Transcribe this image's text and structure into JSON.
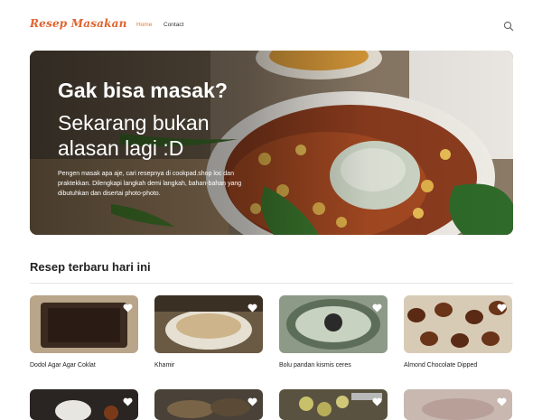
{
  "navbar": {
    "brand": "Resep Masakan",
    "links": [
      {
        "label": "Home",
        "active": true
      },
      {
        "label": "Contact",
        "active": false
      }
    ],
    "search_icon": "search-icon"
  },
  "hero": {
    "heading": "Gak bisa masak?",
    "subheading": "Sekarang bukan alasan lagi :D",
    "description": "Pengen masak apa aje, cari resepnya di cookpad.shop loc dan praktekkan. Dilengkapi langkah demi langkah, bahan-bahan yang dibutuhkan dan disertai photo-photo."
  },
  "recipes": {
    "title": "Resep terbaru hari ini",
    "items": [
      {
        "title": "Dodol Agar Agar Coklat"
      },
      {
        "title": "Khamir"
      },
      {
        "title": "Bolu pandan kismis ceres"
      },
      {
        "title": "Almond Chocolate Dipped"
      }
    ]
  },
  "colors": {
    "brand": "#e0632e",
    "active_link": "#e07a32"
  }
}
